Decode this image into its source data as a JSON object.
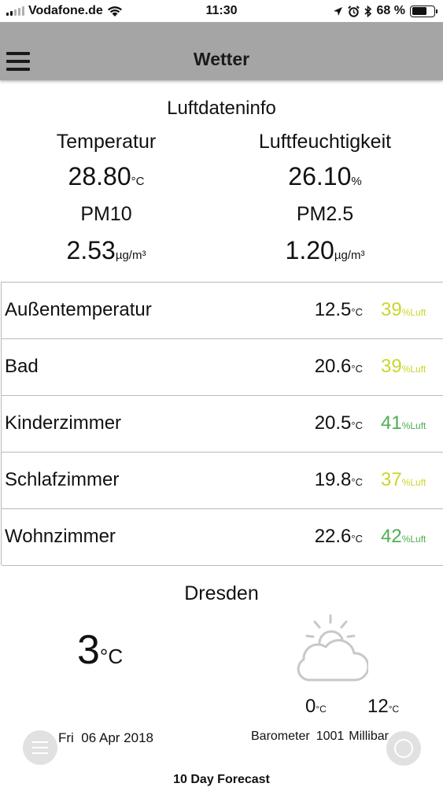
{
  "status_bar": {
    "carrier": "Vodafone.de",
    "time": "11:30",
    "battery": "68 %",
    "battery_level": 0.68
  },
  "header": {
    "title": "Wetter"
  },
  "luftdaten": {
    "title": "Luftdateninfo",
    "temperature": {
      "label": "Temperatur",
      "value": "28.80",
      "unit": "°C"
    },
    "humidity": {
      "label": "Luftfeuchtigkeit",
      "value": "26.10",
      "unit": "%"
    },
    "pm10": {
      "label": "PM10",
      "value": "2.53",
      "unit": "µg/m³"
    },
    "pm25": {
      "label": "PM2.5",
      "value": "1.20",
      "unit": "µg/m³"
    }
  },
  "rooms": [
    {
      "name": "Außentemperatur",
      "temp": "12.5",
      "temp_unit": "°C",
      "humidity": "39",
      "humidity_unit": "%Luft",
      "humidity_color": "#c9d62c"
    },
    {
      "name": "Bad",
      "temp": "20.6",
      "temp_unit": "°C",
      "humidity": "39",
      "humidity_unit": "%Luft",
      "humidity_color": "#c9d62c"
    },
    {
      "name": "Kinderzimmer",
      "temp": "20.5",
      "temp_unit": "°C",
      "humidity": "41",
      "humidity_unit": "%Luft",
      "humidity_color": "#4caf50"
    },
    {
      "name": "Schlafzimmer",
      "temp": "19.8",
      "temp_unit": "°C",
      "humidity": "37",
      "humidity_unit": "%Luft",
      "humidity_color": "#c9d62c"
    },
    {
      "name": "Wohnzimmer",
      "temp": "22.6",
      "temp_unit": "°C",
      "humidity": "42",
      "humidity_unit": "%Luft",
      "humidity_color": "#4caf50"
    }
  ],
  "weather": {
    "city": "Dresden",
    "current_temp": "3",
    "current_unit": "°C",
    "icon": "partly-cloudy-icon",
    "min_temp": "0",
    "max_temp": "12",
    "temp_unit": "°C",
    "day": "Fri",
    "date": "06 Apr 2018",
    "barometer_label": "Barometer",
    "barometer_value": "1001",
    "barometer_unit": "Millibar"
  },
  "footer": {
    "forecast_label": "10 Day Forecast"
  },
  "colors": {
    "header_bg": "#a5a5a5",
    "humidity_yellow": "#c9d62c",
    "humidity_green": "#4caf50"
  }
}
